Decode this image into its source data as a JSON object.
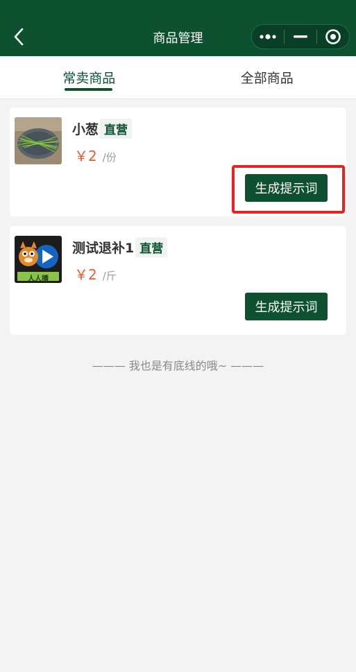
{
  "header": {
    "title": "商品管理",
    "back_icon": "chevron-left-icon",
    "capsule": {
      "more_icon": "more-dots-icon",
      "minimize_icon": "minimize-icon",
      "close_icon": "target-circle-icon"
    }
  },
  "tabs": [
    {
      "label": "常卖商品",
      "active": true
    },
    {
      "label": "全部商品",
      "active": false
    }
  ],
  "products": [
    {
      "name": "小葱",
      "tag": "直营",
      "price": "￥2",
      "unit": "/份",
      "button_label": "生成提示词",
      "image": "scallion-photo"
    },
    {
      "name": "测试退补1",
      "tag": "直营",
      "price": "￥2",
      "unit": "/斤",
      "button_label": "生成提示词",
      "image": "cartoon-logo",
      "image_text": "人人播"
    }
  ],
  "footer": {
    "text": "——— 我也是有底线的哦~ ———"
  },
  "colors": {
    "brand": "#0d5131",
    "price": "#e85b2c",
    "highlight": "#e8231f",
    "background": "#f3f3f3"
  }
}
